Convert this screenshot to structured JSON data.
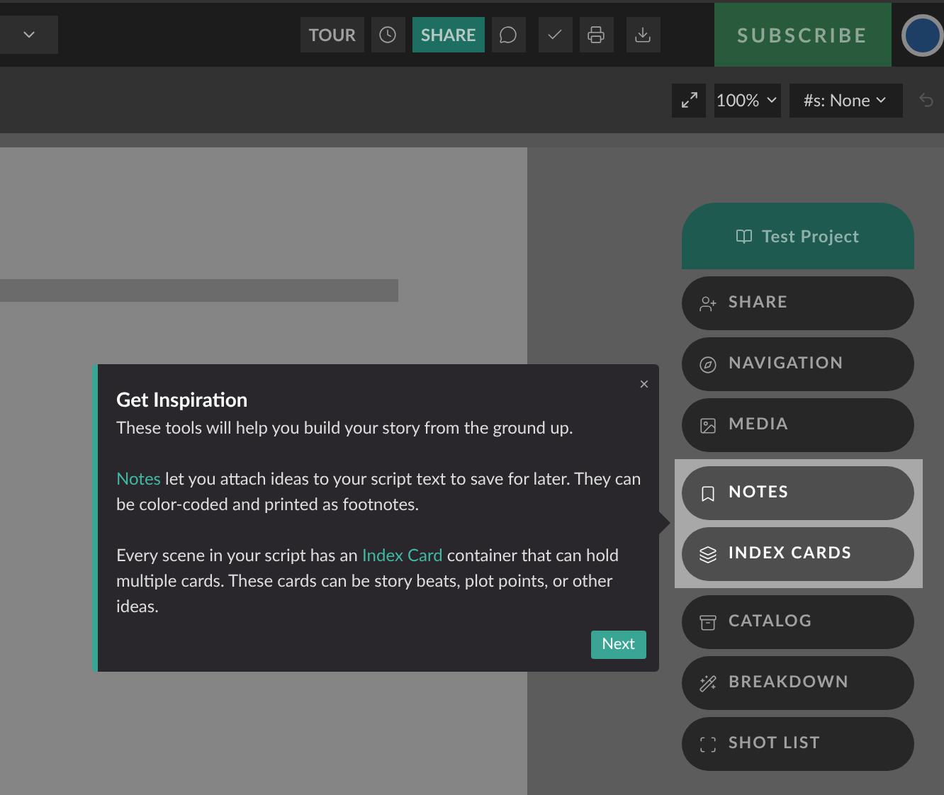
{
  "topbar": {
    "buttons": [
      {
        "kind": "text",
        "label": "TOUR",
        "selected": false
      },
      {
        "kind": "clock",
        "selected": false
      },
      {
        "kind": "text",
        "label": "SHARE",
        "selected": true
      },
      {
        "kind": "chat",
        "selected": false
      },
      {
        "kind": "check",
        "selected": false
      },
      {
        "kind": "print",
        "selected": false
      },
      {
        "kind": "download",
        "selected": false
      }
    ],
    "subscribe": "SUBSCRIBE"
  },
  "toolbar": {
    "zoom": "100%",
    "scenes": "#s: None"
  },
  "popover": {
    "title": "Get Inspiration",
    "close": "×",
    "paragraphs": [
      [
        {
          "text": "These tools will help you build your story from the ground up.",
          "link": false
        }
      ],
      [
        {
          "text": "Notes",
          "link": true
        },
        {
          "text": " let you attach ideas to your script text to save for later. They can be color-coded and printed as footnotes.",
          "link": false
        }
      ],
      [
        {
          "text": "Every scene in your script has an ",
          "link": false
        },
        {
          "text": "Index Card",
          "link": true
        },
        {
          "text": " container that can hold multiple cards. These cards can be story beats, plot points, or other ideas.",
          "link": false
        }
      ]
    ],
    "next": "Next"
  },
  "sidebar": {
    "project": "Test Project",
    "items": [
      {
        "kind": "share",
        "label": "SHARE",
        "highlighted": false
      },
      {
        "kind": "navigation",
        "label": "NAVIGATION",
        "highlighted": false
      },
      {
        "kind": "media",
        "label": "MEDIA",
        "highlighted": false
      },
      {
        "kind": "notes",
        "label": "NOTES",
        "highlighted": true
      },
      {
        "kind": "cards",
        "label": "INDEX CARDS",
        "highlighted": true
      },
      {
        "kind": "catalog",
        "label": "CATALOG",
        "highlighted": false
      },
      {
        "kind": "breakdown",
        "label": "BREAKDOWN",
        "highlighted": false
      },
      {
        "kind": "shotlist",
        "label": "SHOT LIST",
        "highlighted": false
      }
    ]
  }
}
